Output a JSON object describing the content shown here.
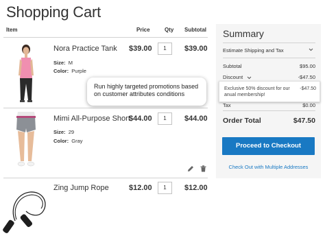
{
  "page": {
    "title": "Shopping Cart"
  },
  "columns": {
    "item": "Item",
    "price": "Price",
    "qty": "Qty",
    "subtotal": "Subtotal"
  },
  "items": [
    {
      "name": "Nora Practice Tank",
      "price": "$39.00",
      "qty": "1",
      "subtotal": "$39.00",
      "options": [
        {
          "label": "Size:",
          "value": "M"
        },
        {
          "label": "Color:",
          "value": "Purple"
        }
      ]
    },
    {
      "name": "Mimi All-Purpose Short",
      "price": "$44.00",
      "qty": "1",
      "subtotal": "$44.00",
      "options": [
        {
          "label": "Size:",
          "value": "29"
        },
        {
          "label": "Color:",
          "value": "Gray"
        }
      ]
    },
    {
      "name": "Zing Jump Rope",
      "price": "$12.00",
      "qty": "1",
      "subtotal": "$12.00",
      "options": []
    }
  ],
  "summary": {
    "title": "Summary",
    "estimate_label": "Estimate Shipping and Tax",
    "subtotal_label": "Subtotal",
    "subtotal_value": "$95.00",
    "discount_label": "Discount",
    "discount_value": "-$47.50",
    "discount_detail_text": "Exclusive 50% discount for our anual membership!",
    "discount_detail_value": "-$47.50",
    "tax_label": "Tax",
    "tax_value": "$0.00",
    "order_total_label": "Order Total",
    "order_total_value": "$47.50",
    "checkout_button": "Proceed to Checkout",
    "multi_address_link": "Check Out with Multiple Addresses"
  },
  "tooltip": {
    "text": "Run highly targeted promotions based on customer attributes conditions"
  },
  "colors": {
    "primary_button": "#1979c3",
    "summary_bg": "#f5f5f5",
    "link": "#1979c3"
  },
  "icons": {
    "edit": "pencil-icon",
    "delete": "trash-icon",
    "expand": "chevron-down-icon"
  }
}
